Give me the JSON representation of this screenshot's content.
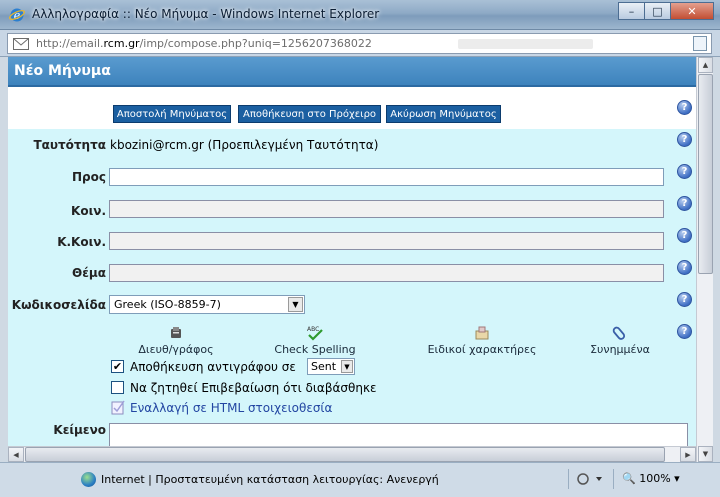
{
  "window": {
    "title": "Αλληλογραφία :: Νέο Μήνυμα - Windows Internet Explorer",
    "minimize": "–",
    "maximize": "□",
    "close": "✕"
  },
  "address": {
    "url_prefix": "http://email.",
    "url_domain": "rcm.gr",
    "url_path": "/imp/compose.php?uniq=1256207368022"
  },
  "page": {
    "header_title": "Νέο Μήνυμα",
    "buttons": {
      "send": "Αποστολή Μηνύματος",
      "save_draft": "Αποθήκευση στο Πρόχειρο",
      "cancel": "Ακύρωση Μηνύματος"
    },
    "help_glyph": "?",
    "fields": {
      "identity_label": "Ταυτότητα",
      "identity_value": "kbozini@rcm.gr (Προεπιλεγμένη Ταυτότητα)",
      "to_label": "Προς",
      "cc_label": "Κοιν.",
      "bcc_label": "Κ.Κοιν.",
      "subject_label": "Θέμα",
      "charset_label": "Κωδικοσελίδα",
      "charset_value": "Greek (ISO-8859-7)",
      "body_label": "Κείμενο"
    },
    "tools": {
      "address_book": "Διευθ/γράφος",
      "spell_check": "Check Spelling",
      "special_chars": "Ειδικοί χαρακτήρες",
      "attachments": "Συνημμένα"
    },
    "options": {
      "save_copy_label": "Αποθήκευση αντιγράφου σε",
      "save_copy_checked": true,
      "save_copy_folder": "Sent",
      "read_receipt_label": "Να ζητηθεί Επιβεβαίωση ότι διαβάσθηκε",
      "read_receipt_checked": false,
      "html_toggle": "Εναλλαγή σε HTML στοιχειοθεσία"
    }
  },
  "status": {
    "text": "Internet | Προστατευμένη κατάσταση λειτουργίας: Ανενεργή",
    "zoom": "100%"
  },
  "colors": {
    "header_blue": "#3d83bd",
    "button_blue": "#1b5fa1",
    "form_cyan": "#d4f6fb",
    "link_blue": "#2346a2"
  }
}
